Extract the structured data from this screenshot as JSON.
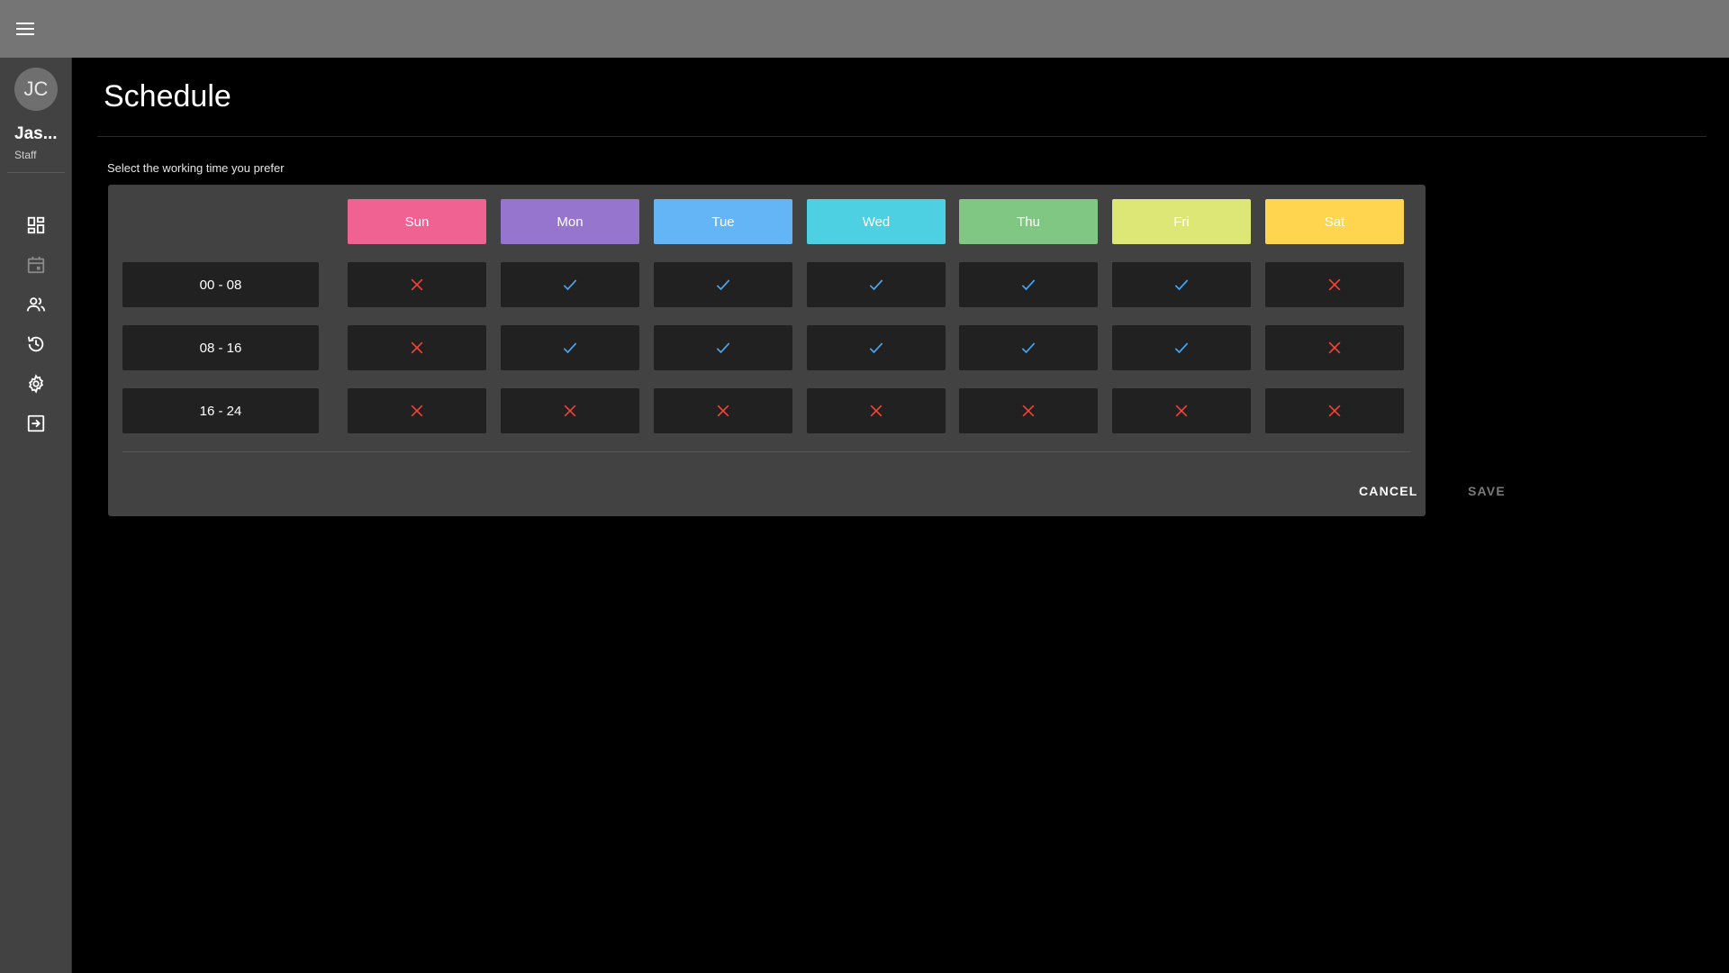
{
  "sidebar": {
    "avatar_initials": "JC",
    "user_name": "Jas...",
    "user_role": "Staff",
    "nav_items": [
      {
        "name": "dashboard",
        "icon": "dashboard-icon"
      },
      {
        "name": "schedule",
        "icon": "calendar-icon"
      },
      {
        "name": "staff",
        "icon": "people-icon"
      },
      {
        "name": "history",
        "icon": "history-icon"
      },
      {
        "name": "settings",
        "icon": "gear-icon"
      },
      {
        "name": "logout",
        "icon": "exit-icon"
      }
    ]
  },
  "header": {
    "menu_icon": "hamburger-menu-icon"
  },
  "page": {
    "title": "Schedule",
    "subtitle": "Select the working time you prefer"
  },
  "schedule": {
    "days": [
      {
        "label": "Sun",
        "color": "#f06292"
      },
      {
        "label": "Mon",
        "color": "#9575cd"
      },
      {
        "label": "Tue",
        "color": "#64b5f6"
      },
      {
        "label": "Wed",
        "color": "#4dd0e1"
      },
      {
        "label": "Thu",
        "color": "#81c784"
      },
      {
        "label": "Fri",
        "color": "#dce775"
      },
      {
        "label": "Sat",
        "color": "#ffd54f"
      }
    ],
    "rows": [
      {
        "label": "00 - 08",
        "cells": [
          false,
          true,
          true,
          true,
          true,
          true,
          false
        ]
      },
      {
        "label": "08 - 16",
        "cells": [
          false,
          true,
          true,
          true,
          true,
          true,
          false
        ]
      },
      {
        "label": "16 - 24",
        "cells": [
          false,
          false,
          false,
          false,
          false,
          false,
          false
        ]
      }
    ],
    "check_color": "#42a5f5",
    "cross_color": "#f44336"
  },
  "actions": {
    "cancel_label": "CANCEL",
    "save_label": "SAVE"
  }
}
